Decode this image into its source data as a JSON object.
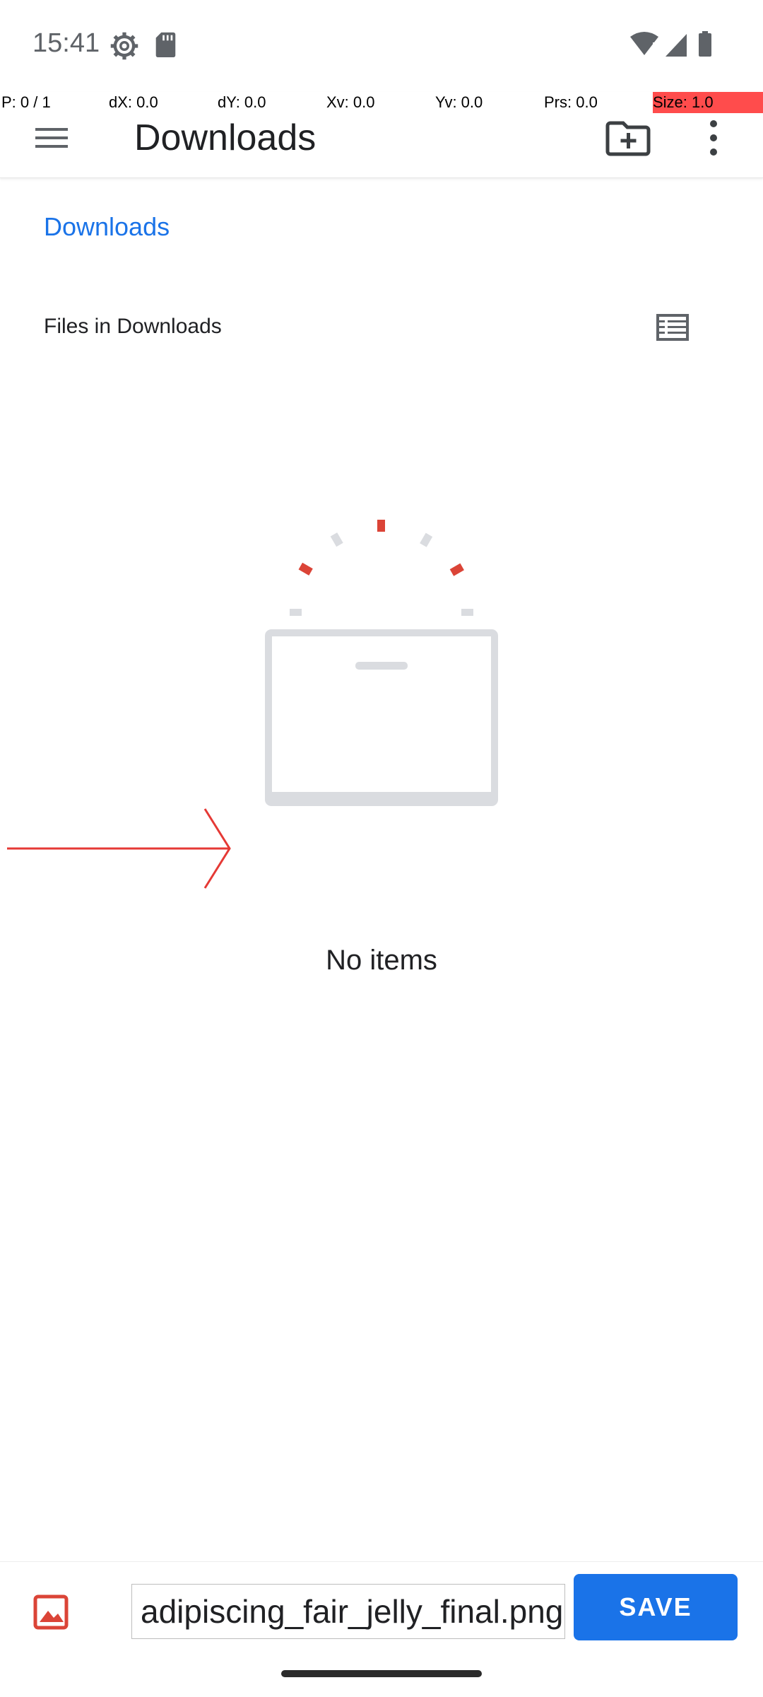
{
  "status_bar": {
    "time": "15:41",
    "icons": [
      "settings-icon",
      "sd-card-icon",
      "wifi-alert-icon",
      "signal-icon",
      "battery-icon"
    ]
  },
  "pointer_overlay": {
    "p": "P: 0 / 1",
    "dx": "dX: 0.0",
    "dy": "dY: 0.0",
    "xv": "Xv: 0.0",
    "yv": "Yv: 0.0",
    "prs": "Prs: 0.0",
    "size": "Size: 1.0"
  },
  "app_bar": {
    "title": "Downloads",
    "icons": [
      "menu-icon",
      "new-folder-icon",
      "more-vert-icon"
    ]
  },
  "breadcrumb": {
    "root": "Downloads"
  },
  "content": {
    "section_header": "Files in Downloads",
    "empty_message": "No items"
  },
  "bottom_bar": {
    "filename_value": "adipiscing_fair_jelly_final.png",
    "save_label": "SAVE"
  },
  "colors": {
    "accent": "#1a73e8",
    "illustration_red": "#db4437",
    "illustration_gray": "#dadce0"
  }
}
